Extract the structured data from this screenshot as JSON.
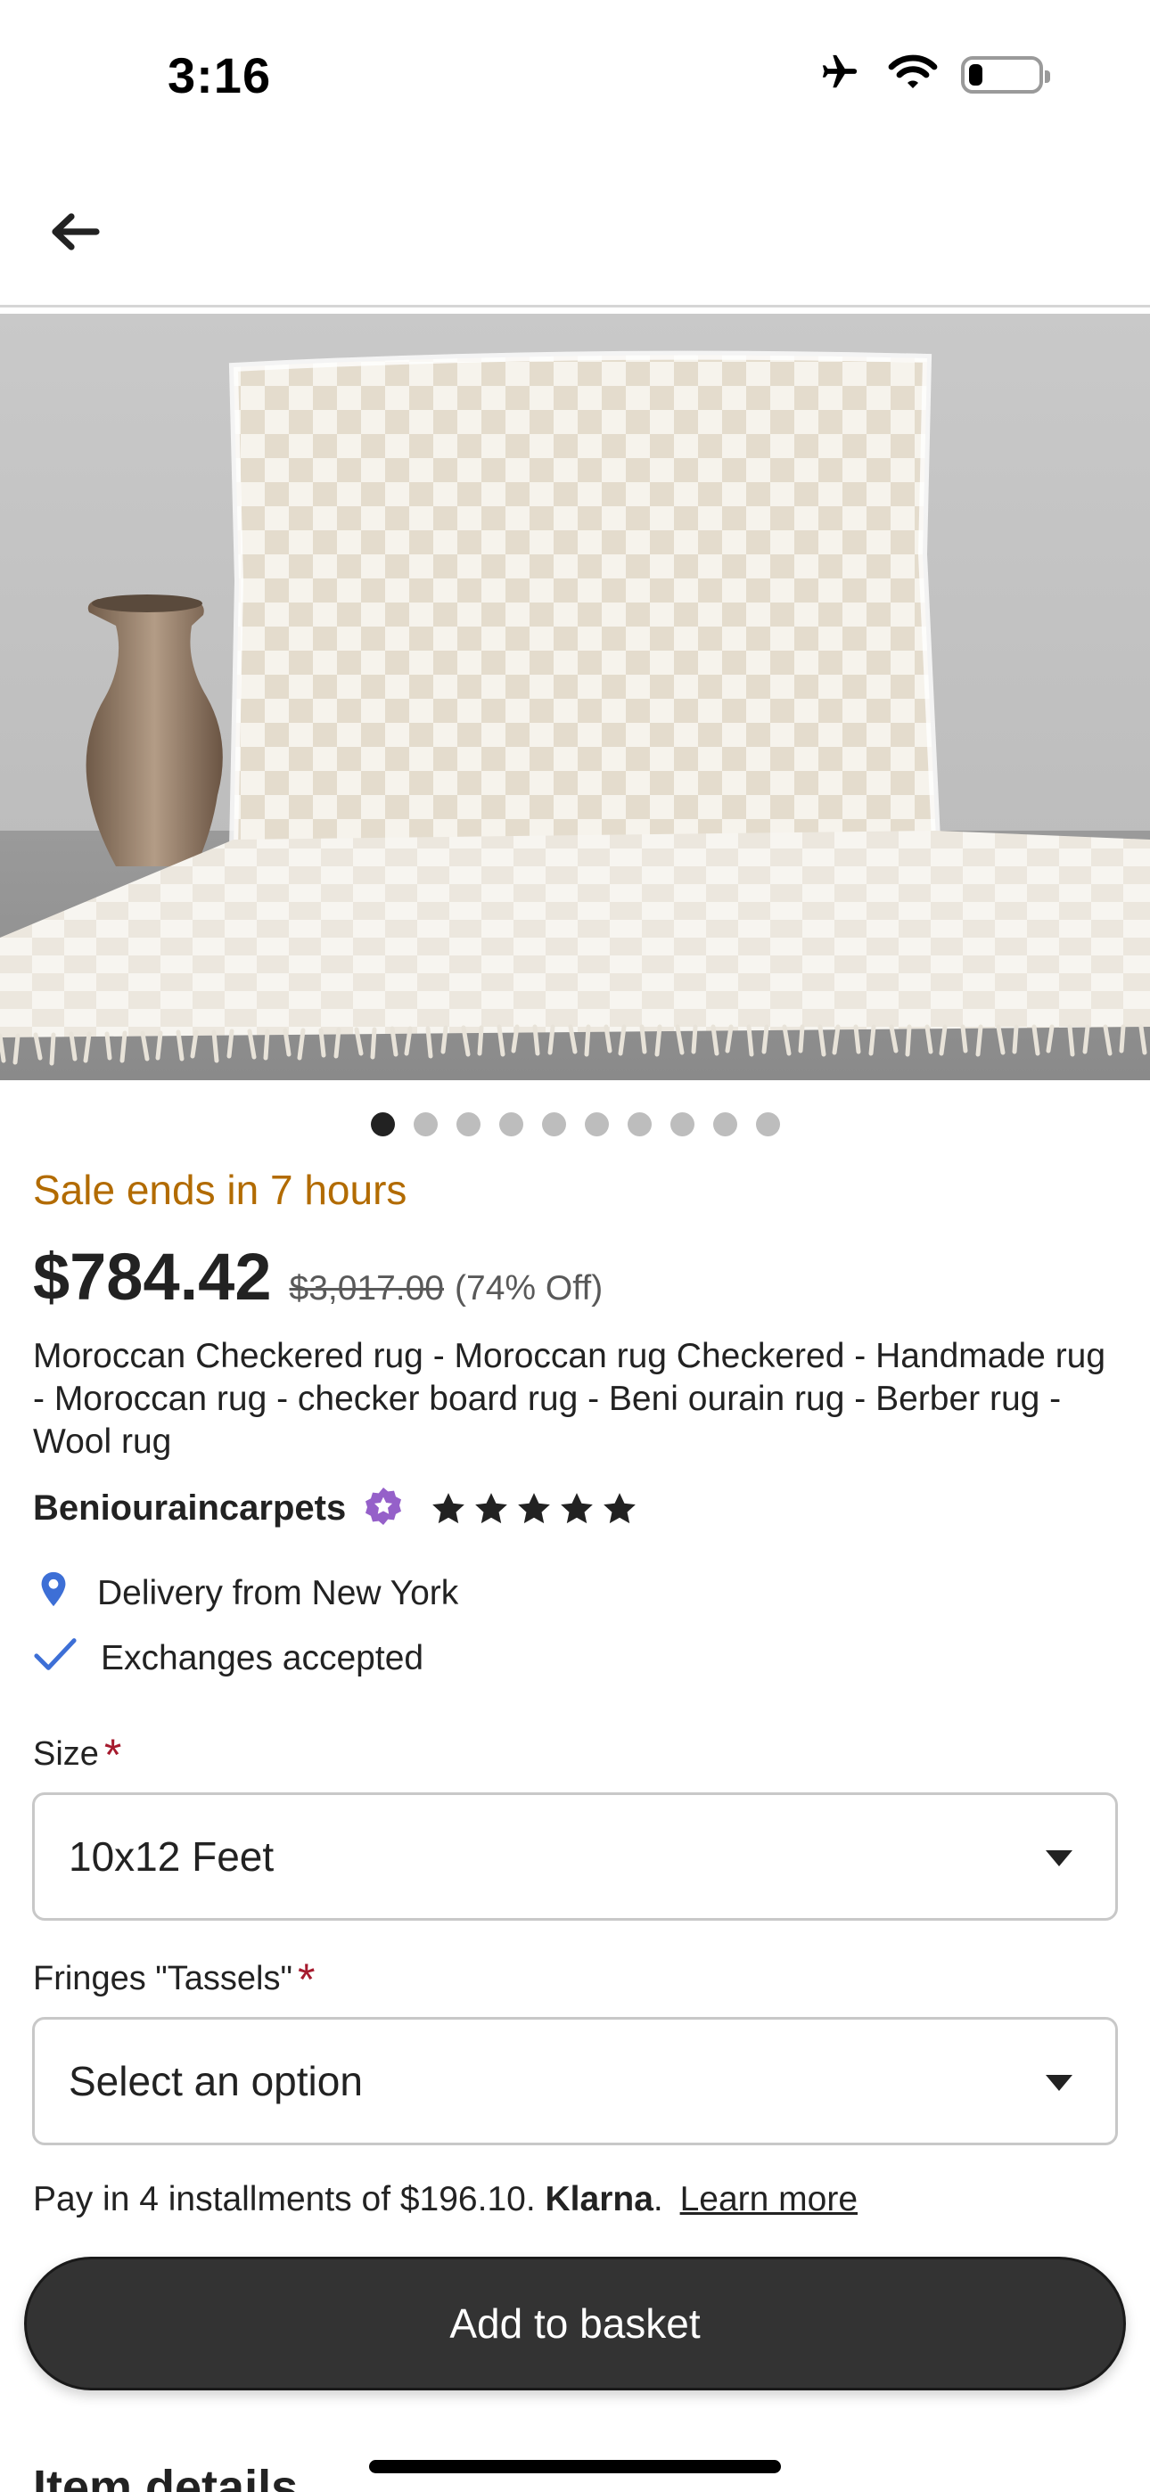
{
  "status_bar": {
    "time": "3:16",
    "icons": [
      "airplane-icon",
      "wifi-icon",
      "battery-icon"
    ],
    "battery_level": 0.2
  },
  "nav": {
    "back_icon": "arrow-left-icon"
  },
  "gallery": {
    "image_count": 10,
    "active_index": 0
  },
  "listing": {
    "sale_text": "Sale ends in 7 hours",
    "price": "$784.42",
    "original_price": "$3,017.00",
    "discount": "(74% Off)",
    "title": "Moroccan Checkered rug - Moroccan rug Checkered - Handmade rug - Moroccan rug - checker board rug - Beni ourain rug - Berber rug - Wool rug",
    "shop_name": "Beniouraincarpets",
    "rating_stars": 5,
    "delivery": "Delivery from New York",
    "exchanges": "Exchanges accepted"
  },
  "options": {
    "size_label": "Size",
    "size_value": "10x12 Feet",
    "fringes_label": "Fringes \"Tassels\"",
    "fringes_value": "Select an option",
    "required_mark": "*"
  },
  "payment": {
    "installments_text": "Pay in 4 installments of $196.10.",
    "provider": "Klarna",
    "provider_suffix": ".",
    "learn_more": "Learn more"
  },
  "actions": {
    "add_to_basket": "Add to basket"
  },
  "next_section": {
    "heading": "Item details"
  },
  "colors": {
    "sale": "#b26b00",
    "button_bg": "#333333",
    "required": "#a61a2e",
    "accent_icon": "#3d6fd6",
    "star_seller_badge": "#9560c9"
  }
}
